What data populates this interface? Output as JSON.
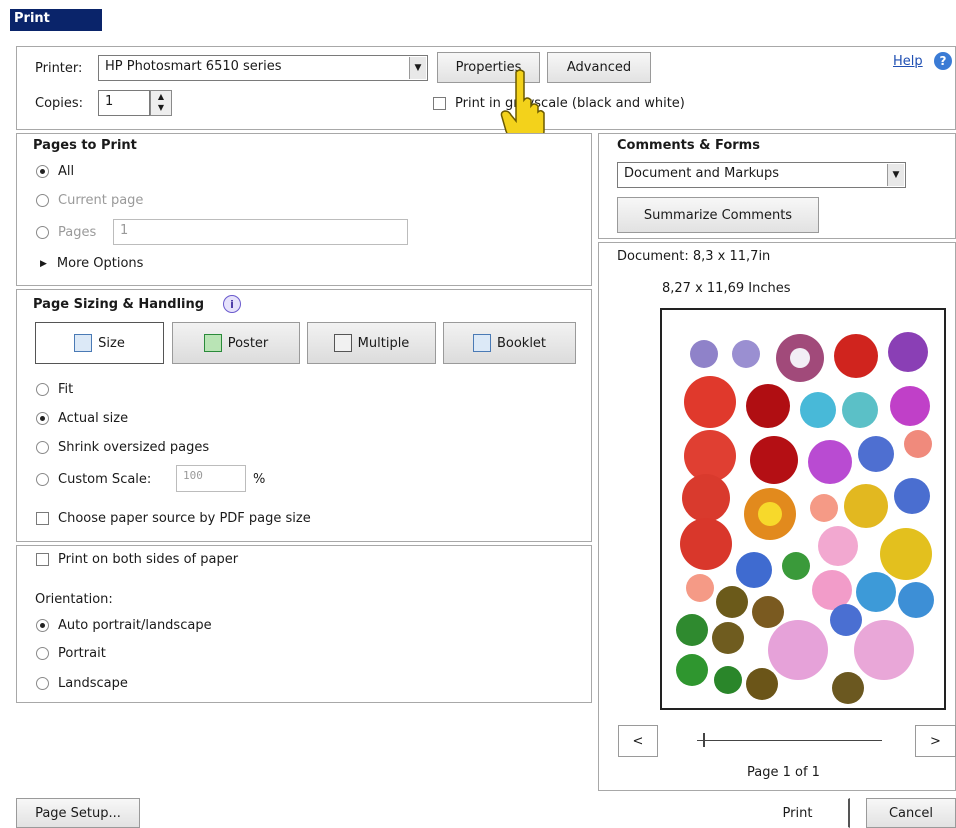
{
  "window": {
    "title": "Print"
  },
  "printer_row": {
    "printer_label": "Printer:",
    "printer_value": "HP Photosmart 6510 series",
    "properties_label": "Properties",
    "advanced_label": "Advanced",
    "help_label": "Help",
    "copies_label": "Copies:",
    "copies_value": "1",
    "grayscale_label": "Print in grayscale (black and white)"
  },
  "pages_to_print": {
    "title": "Pages to Print",
    "all_label": "All",
    "current_label": "Current page",
    "pages_label": "Pages",
    "pages_value": "1",
    "more_label": "More Options"
  },
  "sizing": {
    "title": "Page Sizing & Handling",
    "tabs": [
      "Size",
      "Poster",
      "Multiple",
      "Booklet"
    ],
    "fit_label": "Fit",
    "actual_label": "Actual size",
    "shrink_label": "Shrink oversized pages",
    "custom_label": "Custom Scale:",
    "custom_value": "100",
    "percent": "%",
    "paper_source_label": "Choose paper source by PDF page size"
  },
  "orientation": {
    "both_sides_label": "Print on both sides of paper",
    "title": "Orientation:",
    "auto_label": "Auto portrait/landscape",
    "portrait_label": "Portrait",
    "landscape_label": "Landscape"
  },
  "comments": {
    "title": "Comments & Forms",
    "value": "Document and Markups",
    "summarize_label": "Summarize Comments"
  },
  "preview": {
    "document_label": "Document: 8,3 x 11,7in",
    "size_label": "8,27 x 11,69 Inches",
    "prev": "<",
    "next": ">",
    "page_label": "Page 1 of 1"
  },
  "footer": {
    "page_setup": "Page Setup...",
    "print": "Print",
    "cancel": "Cancel"
  },
  "colors": {
    "titlebar": "#0a246a",
    "help_icon": "#3a7bd5",
    "cursor": "#f3d21b"
  }
}
